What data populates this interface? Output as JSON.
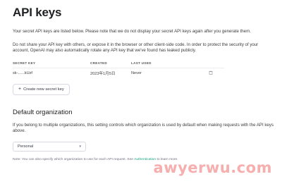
{
  "page": {
    "title": "API keys",
    "intro": "Your secret API keys are listed below. Please note that we do not display your secret API keys again after you generate them.",
    "warning": "Do not share your API key with others, or expose it in the browser or other client-side code. In order to protect the security of your account, OpenAI may also automatically rotate any API key that we've found has leaked publicly."
  },
  "keys_table": {
    "headers": [
      "SECRET KEY",
      "CREATED",
      "LAST USED"
    ],
    "rows": [
      {
        "secret_key": "sk-......kUzf",
        "created": "2023年1月5日",
        "last_used": "Never",
        "delete_icon": "trash-icon"
      }
    ]
  },
  "create_button": {
    "label": "Create new secret key",
    "icon": "plus-icon"
  },
  "default_org": {
    "heading": "Default organization",
    "description": "If you belong to multiple organizations, this setting controls which organization is used by default when making requests with the API keys above.",
    "select_value": "Personal",
    "note_prefix": "Note: You can also specify which organization to use for each API request. See ",
    "note_link": "Authentication",
    "note_suffix": " to learn more."
  },
  "watermark": {
    "text": "awyerwu.com",
    "color": "#ef6d6d"
  },
  "colors": {
    "accent": "#10a37f",
    "border": "#d9d9e3",
    "text": "#353740"
  }
}
